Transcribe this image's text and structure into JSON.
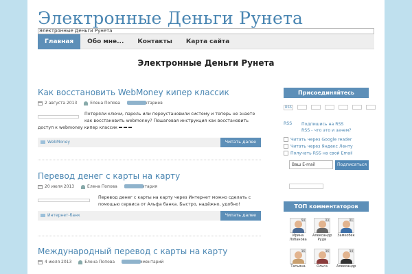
{
  "site": {
    "title": "Электронные Деньги Рунета",
    "tagline": "Электронные Деньги Рунета"
  },
  "nav": {
    "items": [
      {
        "label": "Главная",
        "active": true
      },
      {
        "label": "Обо мне...",
        "active": false
      },
      {
        "label": "Контакты",
        "active": false
      },
      {
        "label": "Карта сайта",
        "active": false
      }
    ]
  },
  "page_heading": "Электронные Деньги Рунета",
  "posts": [
    {
      "title": "Как восстановить WebMoney кипер классик",
      "date": "2 августа 2013",
      "author": "Елена Попова",
      "comments": "6 комментариев",
      "excerpt": "Потеряли ключи, пароль или переустановили систему и теперь не знаете как восстановить webmoney? Пошаговая инструкция как восстановить доступ к webmoney кипер классик",
      "category": "WebMoney",
      "more": "Читать далее"
    },
    {
      "title": "Перевод денег с карты на карту",
      "date": "20 июля 2013",
      "author": "Елена Попова",
      "comments": "2 комментария",
      "excerpt": "Перевод денег с карты на карту через Интернет можно сделать с помощью сервиса от Альфа банка. Быстро, надёжно, удобно!",
      "category": "Интернет-банк",
      "more": "Читать далее"
    },
    {
      "title": "Международный перевод с карты на карту",
      "date": "4 июля 2013",
      "author": "Елена Попова",
      "comments": "Один комментарий"
    }
  ],
  "sidebar": {
    "join": {
      "title": "Присоединяйтесь",
      "rss_badge": "RSS",
      "rss_link": "RSS",
      "subscribe_rss": "Подпишись на RSS",
      "what_is_rss": "RSS - что это и зачем?",
      "read_google": "Читать через Google reader",
      "read_yandex": "Читать через Яндекс Ленту",
      "email_rss": "Получать RSS на свой Email",
      "email_placeholder": "Ваш E-mail",
      "subscribe_button": "Подписаться"
    },
    "top": {
      "title": "ТОП комментаторов",
      "commenters": [
        {
          "name": "Ирина Лобанова",
          "count": "54"
        },
        {
          "name": "Александр Руди",
          "count": "23"
        },
        {
          "name": "Замкобек",
          "count": "21"
        },
        {
          "name": "Татьяна",
          "count": "16"
        },
        {
          "name": "Ольга",
          "count": "16"
        },
        {
          "name": "Александр",
          "count": "14"
        }
      ]
    }
  },
  "colors": {
    "accent": "#5d8fb8",
    "link": "#4a86b2",
    "background": "#d6ebf5"
  }
}
